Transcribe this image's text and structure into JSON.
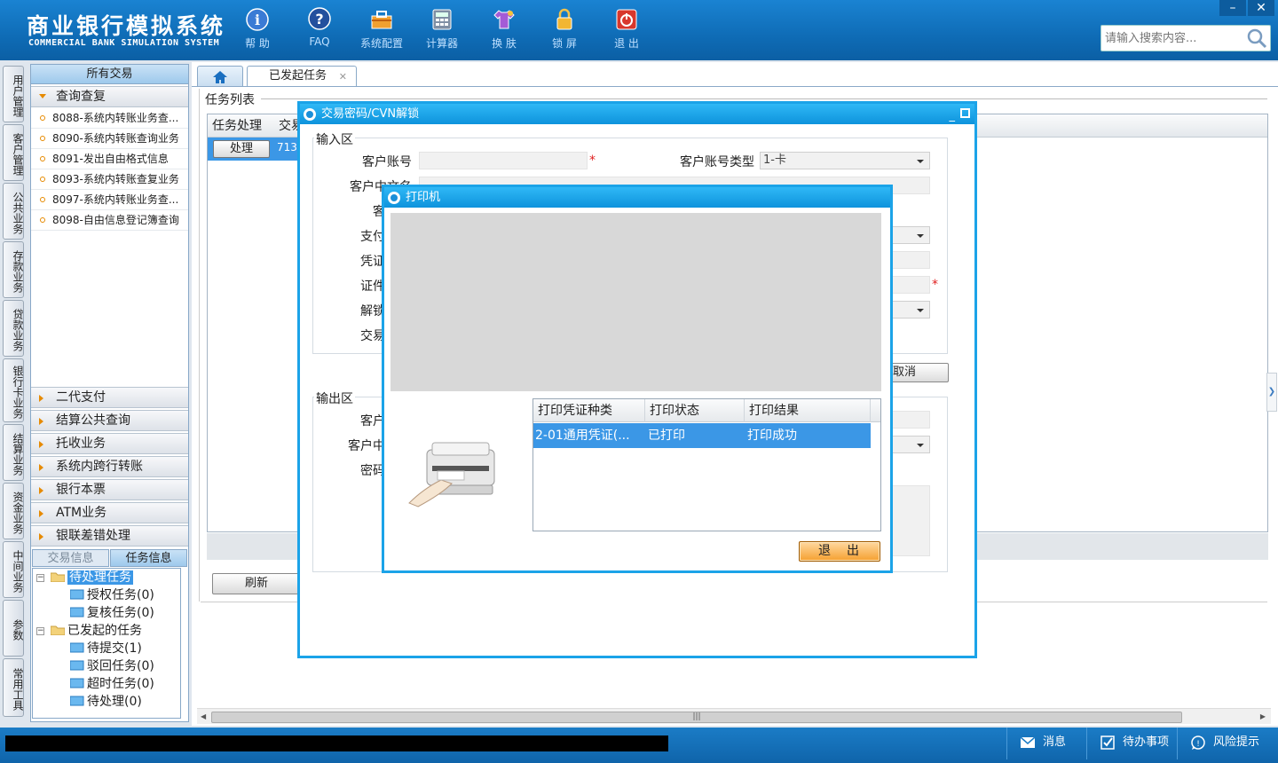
{
  "header": {
    "title_cn": "商业银行模拟系统",
    "title_en": "COMMERCIAL BANK SIMULATION SYSTEM",
    "tools": [
      {
        "label": "帮 助",
        "icon": "help-icon"
      },
      {
        "label": "FAQ",
        "icon": "faq-icon"
      },
      {
        "label": "系统配置",
        "icon": "toolbox-icon"
      },
      {
        "label": "计算器",
        "icon": "calculator-icon"
      },
      {
        "label": "换 肤",
        "icon": "shirt-icon"
      },
      {
        "label": "锁 屏",
        "icon": "lock-icon"
      },
      {
        "label": "退 出",
        "icon": "power-icon"
      }
    ],
    "search_placeholder": "请输入搜索内容...",
    "minimize": "–",
    "close": "✕"
  },
  "vtabs": [
    "用户管理",
    "客户管理",
    "公共业务",
    "存款业务",
    "贷款业务",
    "银行卡业务",
    "结算业务",
    "资金业务",
    "中间业务",
    "参数",
    "常用工具"
  ],
  "menu": {
    "header": "所有交易",
    "open_group": "查询查复",
    "open_items": [
      "8088-系统内转账业务查...",
      "8090-系统内转账查询业务",
      "8091-发出自由格式信息",
      "8093-系统内转账查复业务",
      "8097-系统内转账业务查...",
      "8098-自由信息登记簿查询"
    ],
    "groups": [
      "二代支付",
      "结算公共查询",
      "托收业务",
      "系统内跨行转账",
      "银行本票",
      "ATM业务",
      "银联差错处理"
    ]
  },
  "info_tabs": {
    "trade": "交易信息",
    "task": "任务信息"
  },
  "tree": {
    "pending": "待处理任务",
    "auth": "授权任务(0)",
    "review": "复核任务(0)",
    "initiated": "已发起的任务",
    "to_submit": "待提交(1)",
    "rejected": "驳回任务(0)",
    "timeout": "超时任务(0)",
    "to_process": "待处理(0)"
  },
  "main": {
    "tab_label": "已发起任务",
    "tab_close": "✕",
    "task_list_title": "任务列表",
    "col_process": "任务处理",
    "col_trade": "交易",
    "process_btn": "处理",
    "row_id": "7132",
    "refresh_btn": "刷新"
  },
  "dialog_txn": {
    "title": "交易密码/CVN解锁",
    "minimize": "_",
    "input_section": "输入区",
    "output_section": "输出区",
    "labels": {
      "account": "客户账号",
      "account_type": "客户账号类型",
      "name_cn": "客户中文名",
      "row3": "客",
      "row4": "支付",
      "row5": "凭证",
      "row6": "证件",
      "row7": "解锁",
      "row8": "交易",
      "out1": "客户",
      "out2": "客户中",
      "out3": "密码"
    },
    "account_type_value": "1-卡",
    "required_mark": "*",
    "cancel_btn": "取消"
  },
  "dialog_print": {
    "title": "打印机",
    "columns": [
      "打印凭证种类",
      "打印状态",
      "打印结果"
    ],
    "row": {
      "type": "2-01通用凭证(...",
      "status": "已打印",
      "result": "打印成功"
    },
    "exit_btn": "退出"
  },
  "statusbar": {
    "message": "消息",
    "todo": "待办事项",
    "risk": "风险提示"
  },
  "colors": {
    "header_blue": "#0f6cb6",
    "dialog_border": "#1ba3e8",
    "selection": "#3b97e6",
    "accent_orange": "#e68a00"
  }
}
